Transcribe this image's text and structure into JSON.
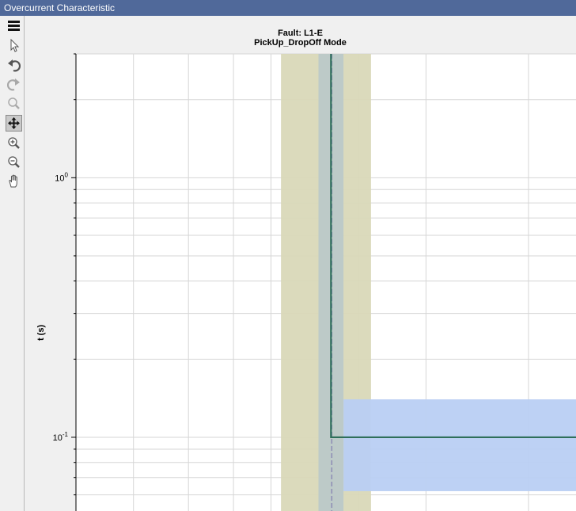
{
  "window": {
    "title": "Overcurrent Characteristic"
  },
  "toolbar": {
    "items": [
      {
        "name": "menu",
        "icon": "hamburger-menu-icon",
        "active": false,
        "enabled": true
      },
      {
        "name": "select",
        "icon": "cursor-arrow-icon",
        "active": false,
        "enabled": true
      },
      {
        "name": "undo",
        "icon": "undo-icon",
        "active": false,
        "enabled": true
      },
      {
        "name": "redo",
        "icon": "redo-icon",
        "active": false,
        "enabled": false
      },
      {
        "name": "zoom",
        "icon": "magnifier-icon",
        "active": false,
        "enabled": false
      },
      {
        "name": "pan",
        "icon": "move-arrows-icon",
        "active": true,
        "enabled": true
      },
      {
        "name": "zoom-in",
        "icon": "zoom-in-icon",
        "active": false,
        "enabled": true
      },
      {
        "name": "zoom-out",
        "icon": "zoom-out-icon",
        "active": false,
        "enabled": true
      },
      {
        "name": "hand",
        "icon": "hand-icon",
        "active": false,
        "enabled": true
      }
    ]
  },
  "chart_data": {
    "type": "line",
    "title": "Fault: L1-E",
    "subtitle": "PickUp_DropOff Mode",
    "ylabel": "t (s)",
    "xlabel": "",
    "yscale": "log",
    "ylim": [
      0.052,
      3.0
    ],
    "xlim": [
      0,
      1
    ],
    "grid": true,
    "y_major_ticks": [
      {
        "value": 1.0,
        "label_base": "10",
        "label_exp": "0"
      },
      {
        "value": 0.1,
        "label_base": "10",
        "label_exp": "-1"
      }
    ],
    "colors": {
      "band_outer": "#d9d8b8",
      "band_inner": "#bcc9c8",
      "region_time": "#b9cff3",
      "curve": "#2f6f5a",
      "vertical_dashed": "#8c8cb4",
      "grid": "#d6d6d6",
      "axis": "#000000"
    },
    "series": [
      {
        "kind": "curve",
        "points": [
          [
            0.51,
            3.0
          ],
          [
            0.51,
            0.1
          ],
          [
            1.0,
            0.1
          ]
        ]
      }
    ],
    "bands": [
      {
        "kind": "current-tolerance-outer",
        "x": [
          0.41,
          0.59
        ]
      },
      {
        "kind": "current-tolerance-inner",
        "x": [
          0.485,
          0.535
        ]
      },
      {
        "kind": "time-tolerance",
        "x_start": 0.535,
        "y": [
          0.062,
          0.14
        ]
      }
    ],
    "vertical_markers": [
      {
        "x": 0.51,
        "style": "dashed"
      }
    ]
  }
}
